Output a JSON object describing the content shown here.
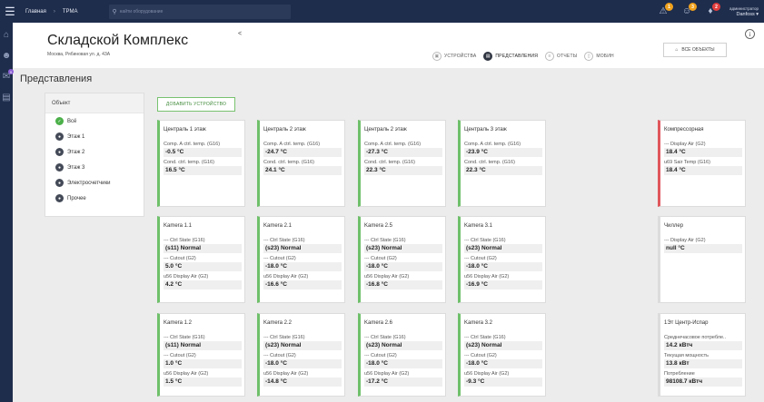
{
  "topbar": {
    "crumbs": [
      "Главная",
      "TPMA"
    ],
    "search_placeholder": "найти оборудование",
    "badges": [
      "1",
      "3",
      "2"
    ],
    "user_role": "администратор",
    "user_name": "Danfoss"
  },
  "rail": {
    "badge": "9"
  },
  "header": {
    "title": "Складской Комплекс",
    "address": "Москва, Рябиновая ул. д. 43А",
    "collapse": "<",
    "tabs": [
      "УСТРОЙСТВА",
      "ПРЕДСТАВЛЕНИЯ",
      "ОТЧЕТЫ",
      "МОБИН"
    ],
    "all_objects": "ВСЕ ОБЪЕКТЫ",
    "info": "i"
  },
  "section_title": "Представления",
  "filter": {
    "header": "Объект",
    "items": [
      "Всё",
      "Этаж 1",
      "Этаж 2",
      "Этаж 3",
      "Электросчетчики",
      "Прочее"
    ]
  },
  "add_device": "ДОБАВИТЬ УСТРОЙСТВО",
  "cards": [
    {
      "name": "Централь 1 этаж",
      "rows": [
        {
          "label": "Comp. A ctrl. temp. (G16)",
          "value": "-0.5 °C"
        },
        {
          "label": "Cond. ctrl. temp. (G16)",
          "value": "16.5 °C"
        }
      ]
    },
    {
      "name": "Централь 2 этаж",
      "rows": [
        {
          "label": "Comp. A ctrl. temp. (G16)",
          "value": "-24.7 °C"
        },
        {
          "label": "Cond. ctrl. temp. (G16)",
          "value": "24.1 °C"
        }
      ]
    },
    {
      "name": "Централь 2 этаж",
      "rows": [
        {
          "label": "Comp. A ctrl. temp. (G16)",
          "value": "-27.3 °C"
        },
        {
          "label": "Cond. ctrl. temp. (G16)",
          "value": "22.3 °C"
        }
      ]
    },
    {
      "name": "Централь 3 этаж",
      "rows": [
        {
          "label": "Comp. A ctrl. temp. (G16)",
          "value": "-23.9 °C"
        },
        {
          "label": "Cond. ctrl. temp. (G16)",
          "value": "22.3 °C"
        }
      ]
    },
    {
      "name": "Компрессорная",
      "rows": [
        {
          "label": "--- Display Air (G2)",
          "value": "18.4 °C"
        },
        {
          "label": "u69 Sair Temp (G16)",
          "value": "18.4 °C"
        }
      ]
    },
    {
      "name": "Kamera 1.1",
      "rows": [
        {
          "label": "--- Ctrl State (G16)",
          "value": "(s11) Normal"
        },
        {
          "label": "--- Cutout (G2)",
          "value": "5.0 °C"
        },
        {
          "label": "u56 Display Air (G2)",
          "value": "4.2 °C"
        }
      ]
    },
    {
      "name": "Kamera 2.1",
      "rows": [
        {
          "label": "--- Ctrl State (G16)",
          "value": "(s23) Normal"
        },
        {
          "label": "--- Cutout (G2)",
          "value": "-18.0 °C"
        },
        {
          "label": "u56 Display Air (G2)",
          "value": "-16.6 °C"
        }
      ]
    },
    {
      "name": "Kamera 2.5",
      "rows": [
        {
          "label": "--- Ctrl State (G16)",
          "value": "(s23) Normal"
        },
        {
          "label": "--- Cutout (G2)",
          "value": "-18.0 °C"
        },
        {
          "label": "u56 Display Air (G2)",
          "value": "-16.8 °C"
        }
      ]
    },
    {
      "name": "Kamera 3.1",
      "rows": [
        {
          "label": "--- Ctrl State (G16)",
          "value": "(s23) Normal"
        },
        {
          "label": "--- Cutout (G2)",
          "value": "-18.0 °C"
        },
        {
          "label": "u56 Display Air (G2)",
          "value": "-16.9 °C"
        }
      ]
    },
    {
      "name": "Чиллер",
      "rows": [
        {
          "label": "--- Display Air (G2)",
          "value": "null °C"
        }
      ]
    },
    {
      "name": "Kamera 1.2",
      "rows": [
        {
          "label": "--- Ctrl State (G16)",
          "value": "(s11) Normal"
        },
        {
          "label": "--- Cutout (G2)",
          "value": "1.0 °C"
        },
        {
          "label": "u56 Display Air (G2)",
          "value": "1.5 °C"
        }
      ]
    },
    {
      "name": "Kamera 2.2",
      "rows": [
        {
          "label": "--- Ctrl State (G16)",
          "value": "(s23) Normal"
        },
        {
          "label": "--- Cutout (G2)",
          "value": "-18.0 °C"
        },
        {
          "label": "u56 Display Air (G2)",
          "value": "-14.8 °C"
        }
      ]
    },
    {
      "name": "Kamera 2.6",
      "rows": [
        {
          "label": "--- Ctrl State (G16)",
          "value": "(s23) Normal"
        },
        {
          "label": "--- Cutout (G2)",
          "value": "-18.0 °C"
        },
        {
          "label": "u56 Display Air (G2)",
          "value": "-17.2 °C"
        }
      ]
    },
    {
      "name": "Kamera 3.2",
      "rows": [
        {
          "label": "--- Ctrl State (G16)",
          "value": "(s23) Normal"
        },
        {
          "label": "--- Cutout (G2)",
          "value": "-18.0 °C"
        },
        {
          "label": "u56 Display Air (G2)",
          "value": "-9.3 °C"
        }
      ]
    },
    {
      "name": "1Эт Центр-Испар",
      "rows": [
        {
          "label": "Среднечасовое потребле..",
          "value": "14.2 кВтч"
        },
        {
          "label": "Текущая мощность",
          "value": "13.8 кВт"
        },
        {
          "label": "Потребление",
          "value": "98108.7 кВтч"
        }
      ]
    }
  ],
  "colors": {
    "nav": "#1f2d4c",
    "ok": "#6fc06a",
    "alarm": "#e0575c",
    "badge_orange": "#f0a21e",
    "badge_red": "#e23d3d"
  }
}
